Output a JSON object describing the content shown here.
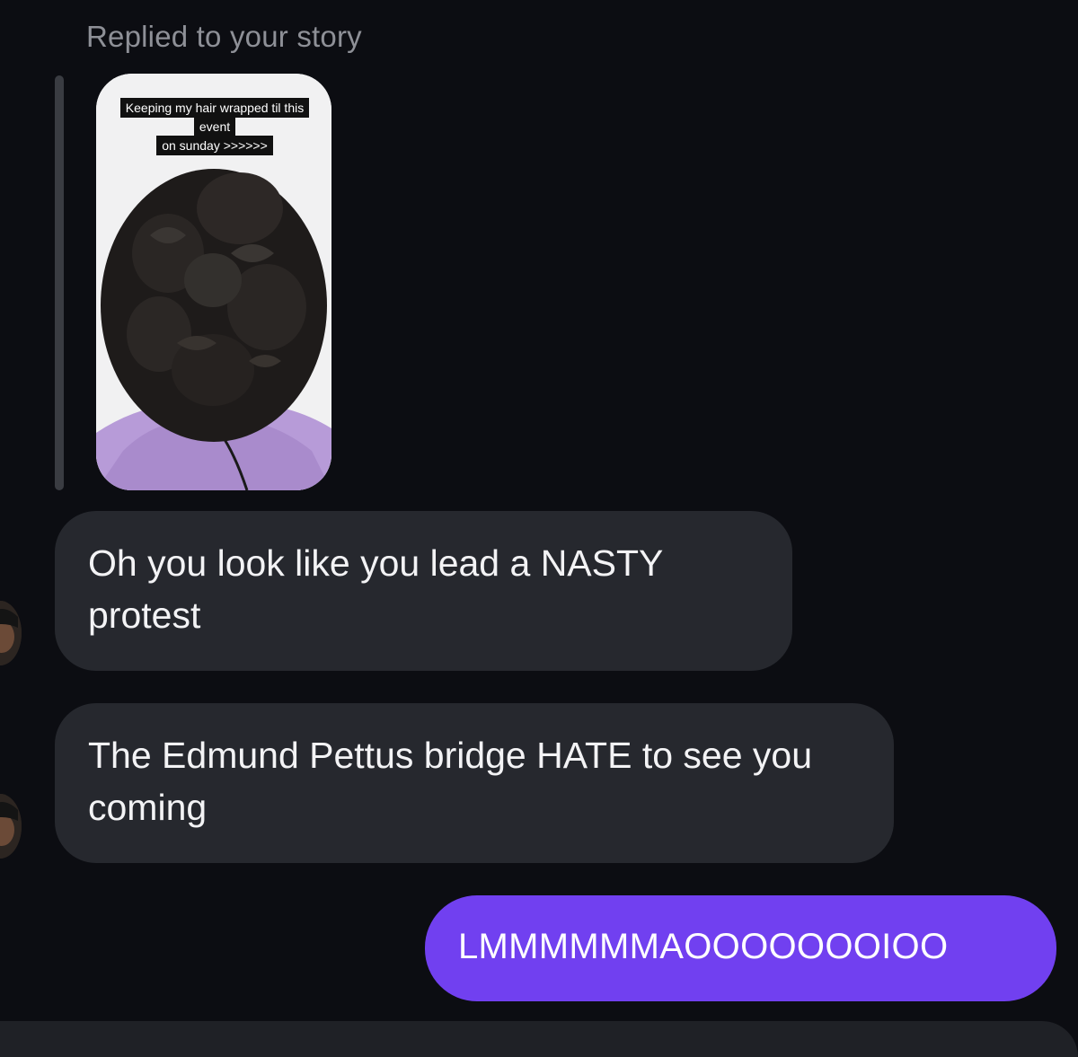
{
  "thread": {
    "reply_context": "Replied to your story",
    "story": {
      "caption_line1": "Keeping my hair wrapped til this event",
      "caption_line2": "on sunday >>>>>>"
    },
    "messages": [
      {
        "sender": "them",
        "text": "Oh you look like you lead a NASTY protest"
      },
      {
        "sender": "them",
        "text": "The Edmund Pettus bridge HATE to see you coming"
      },
      {
        "sender": "me",
        "text": "LMMMMMMAOOOOOOOIOO"
      }
    ]
  },
  "colors": {
    "background": "#0c0d12",
    "incoming_bubble": "#26282e",
    "outgoing_bubble": "#7140f0",
    "muted_text": "#8e9097"
  }
}
